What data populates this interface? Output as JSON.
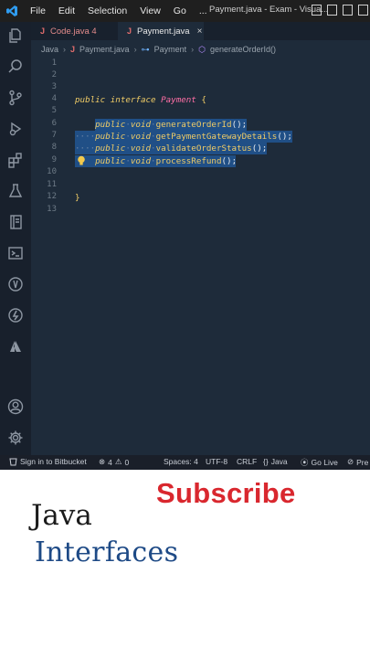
{
  "titlebar": {
    "menu": [
      "File",
      "Edit",
      "Selection",
      "View",
      "Go",
      "..."
    ],
    "window_title": "Payment.java - Exam - Visua..."
  },
  "tabs": [
    {
      "label": "Code.java 4",
      "icon": "java-file-icon",
      "active": false
    },
    {
      "label": "Payment.java",
      "icon": "java-file-icon",
      "active": true,
      "close": "×"
    }
  ],
  "breadcrumb": {
    "root": "Java",
    "file": "Payment.java",
    "symbol": "Payment",
    "method": "generateOrderId()"
  },
  "editor": {
    "line_numbers": [
      "1",
      "2",
      "3",
      "4",
      "5",
      "6",
      "7",
      "8",
      "9",
      "10",
      "11",
      "12",
      "13"
    ],
    "interface_decl": {
      "kw1": "public",
      "kw2": "interface",
      "name": "Payment",
      "brace": "{"
    },
    "methods": [
      {
        "kw": "public",
        "ret": "void",
        "name": "generateOrderId",
        "tail": "();"
      },
      {
        "kw": "public",
        "ret": "void",
        "name": "getPaymentGatewayDetails",
        "tail": "();"
      },
      {
        "kw": "public",
        "ret": "void",
        "name": "validateOrderStatus",
        "tail": "();"
      },
      {
        "kw": "public",
        "ret": "void",
        "name": "processRefund",
        "tail": "();"
      }
    ],
    "closing_brace": "}"
  },
  "statusbar": {
    "bitbucket": "Sign in to Bitbucket",
    "errors": "4",
    "warnings": "0",
    "spaces": "Spaces: 4",
    "encoding": "UTF-8",
    "eol": "CRLF",
    "language": "Java",
    "golive": "Go Live",
    "prettier": "Pre"
  },
  "promo": {
    "subscribe": "Subscribe",
    "java": "Java",
    "interfaces": "Interfaces"
  },
  "colors": {
    "accent_red": "#d9272e",
    "selection": "#204f86",
    "editor_bg": "#1e2b3a"
  }
}
